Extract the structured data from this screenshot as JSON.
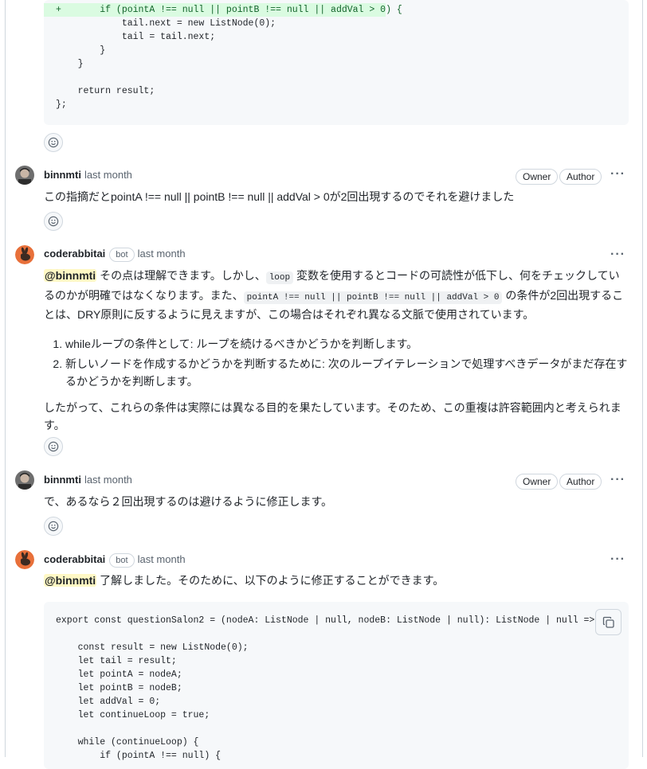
{
  "top_code": {
    "lines": [
      {
        "text": "+       if (pointA !== null || pointB !== null || addVal > 0) {",
        "added": true
      },
      {
        "text": "            tail.next = new ListNode(0);",
        "added": false
      },
      {
        "text": "            tail = tail.next;",
        "added": false
      },
      {
        "text": "        }",
        "added": false
      },
      {
        "text": "    }",
        "added": false
      },
      {
        "text": "",
        "added": false
      },
      {
        "text": "    return result;",
        "added": false
      },
      {
        "text": "};",
        "added": false
      }
    ]
  },
  "comments": [
    {
      "author": "binnmti",
      "time": "last month",
      "badges": [
        "Owner",
        "Author"
      ],
      "text": "この指摘だとpointA !== null || pointB !== null || addVal > 0が2回出現するのでそれを避けました"
    },
    {
      "author": "coderabbitai",
      "bot_label": "bot",
      "time": "last month",
      "mention": "@binnmti",
      "p1_a": " その点は理解できます。しかし、",
      "p1_code1": "loop",
      "p1_b": " 変数を使用するとコードの可読性が低下し、何をチェックしているのかが明確ではなくなります。また、",
      "p1_code2": "pointA !== null || pointB !== null || addVal > 0",
      "p1_c": " の条件が2回出現することは、DRY原則に反するように見えますが、この場合はそれぞれ異なる文脈で使用されています。",
      "list": [
        "whileループの条件として: ループを続けるべきかどうかを判断します。",
        "新しいノードを作成するかどうかを判断するために: 次のループイテレーションで処理すべきデータがまだ存在するかどうかを判断します。"
      ],
      "p2": "したがって、これらの条件は実際には異なる目的を果たしています。そのため、この重複は許容範囲内と考えられます。"
    },
    {
      "author": "binnmti",
      "time": "last month",
      "badges": [
        "Owner",
        "Author"
      ],
      "text": "で、あるなら２回出現するのは避けるように修正します。"
    },
    {
      "author": "coderabbitai",
      "bot_label": "bot",
      "time": "last month",
      "mention": "@binnmti",
      "text": " 了解しました。そのために、以下のように修正することができます。"
    }
  ],
  "bottom_code": {
    "lines": [
      "export const questionSalon2 = (nodeA: ListNode | null, nodeB: ListNode | null): ListNode | null => {",
      "",
      "    const result = new ListNode(0);",
      "    let tail = result;",
      "    let pointA = nodeA;",
      "    let pointB = nodeB;",
      "    let addVal = 0;",
      "    let continueLoop = true;",
      "",
      "    while (continueLoop) {",
      "        if (pointA !== null) {"
    ]
  },
  "icons": {
    "reaction": "smiley-icon",
    "more": "kebab-horizontal-icon",
    "copy": "copy-icon"
  },
  "colors": {
    "mention_bg": "#fff8c5",
    "added_line_bg": "#dafbe1",
    "code_bg": "#f6f8fa"
  }
}
